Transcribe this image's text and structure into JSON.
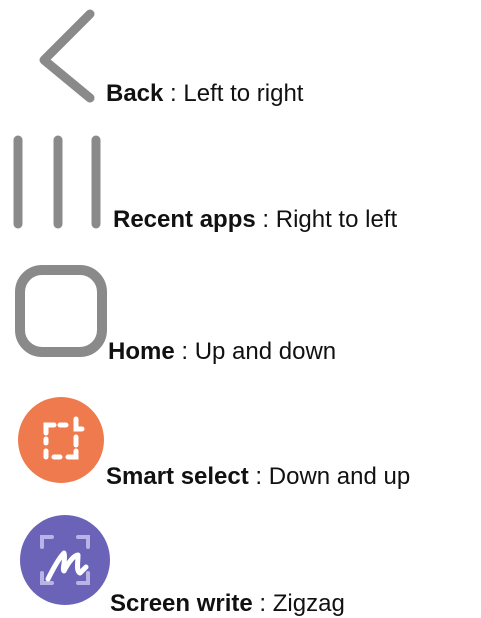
{
  "colors": {
    "gray_icon": "#8a8a8a",
    "smart_select_bg": "#ef7a4e",
    "screen_write_bg": "#6a63b8",
    "text": "#111111"
  },
  "gestures": [
    {
      "name": "Back",
      "separator": " : ",
      "description": "Left to right",
      "icon": "back-chevron-icon"
    },
    {
      "name": "Recent apps",
      "separator": " : ",
      "description": "Right to left",
      "icon": "recent-apps-icon"
    },
    {
      "name": "Home",
      "separator": " : ",
      "description": "Up and down",
      "icon": "home-icon"
    },
    {
      "name": "Smart select",
      "separator": " : ",
      "description": "Down and up",
      "icon": "smart-select-icon"
    },
    {
      "name": "Screen write",
      "separator": " : ",
      "description": "Zigzag",
      "icon": "screen-write-icon"
    }
  ]
}
